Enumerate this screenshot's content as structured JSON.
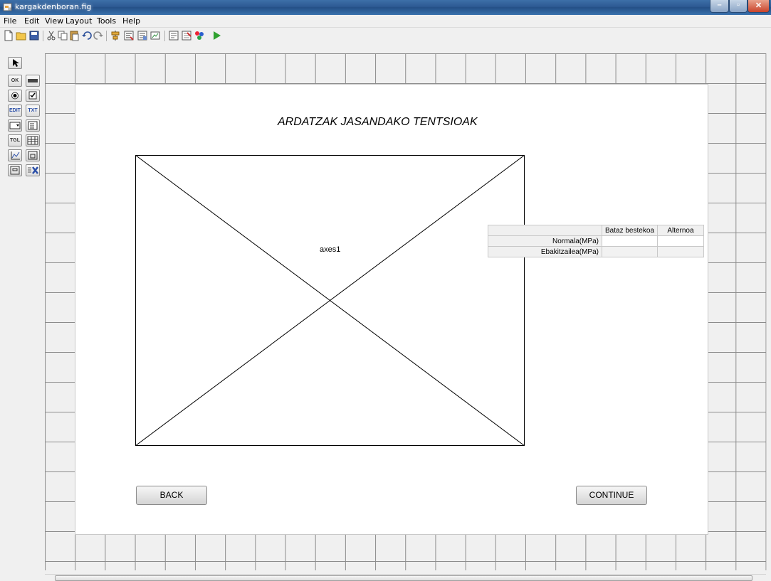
{
  "window": {
    "title": "kargakdenboran.fig"
  },
  "menu": [
    "File",
    "Edit",
    "View",
    "Layout",
    "Tools",
    "Help"
  ],
  "toolbar": {
    "buttons": [
      "new-icon",
      "open-icon",
      "save-icon",
      "cut-icon",
      "copy-icon",
      "paste-icon",
      "undo-icon",
      "redo-icon",
      "align-icon",
      "menu-editor-icon",
      "tab-order-icon",
      "toolbar-editor-icon",
      "mfile-editor-icon",
      "property-inspector-icon",
      "object-browser-icon",
      "run-icon"
    ]
  },
  "palette": {
    "items": [
      {
        "name": "select-tool-icon",
        "label": ""
      },
      {
        "name": "push-button-tool-icon",
        "label": "OK"
      },
      {
        "name": "slider-tool-icon",
        "label": ""
      },
      {
        "name": "radio-button-tool-icon",
        "label": ""
      },
      {
        "name": "checkbox-tool-icon",
        "label": ""
      },
      {
        "name": "edit-text-tool-icon",
        "label": "EDIT"
      },
      {
        "name": "static-text-tool-icon",
        "label": "TXT"
      },
      {
        "name": "popup-menu-tool-icon",
        "label": ""
      },
      {
        "name": "listbox-tool-icon",
        "label": ""
      },
      {
        "name": "toggle-button-tool-icon",
        "label": "TGL"
      },
      {
        "name": "table-tool-icon",
        "label": ""
      },
      {
        "name": "axes-tool-icon",
        "label": ""
      },
      {
        "name": "panel-tool-icon",
        "label": ""
      },
      {
        "name": "button-group-tool-icon",
        "label": ""
      },
      {
        "name": "activex-tool-icon",
        "label": ""
      }
    ]
  },
  "figure": {
    "title": "ARDATZAK JASANDAKO TENTSIOAK",
    "axes_label": "axes1",
    "back_label": "BACK",
    "continue_label": "CONTINUE",
    "table": {
      "columns": [
        "Bataz bestekoa",
        "Alternoa"
      ],
      "rows": [
        "Normala(MPa)",
        "Ebakitzailea(MPa)"
      ]
    }
  },
  "colors": {
    "titlebar": "#2d5a93",
    "canvas_grid": "#8c8c8c",
    "run": "#2fa12f"
  }
}
